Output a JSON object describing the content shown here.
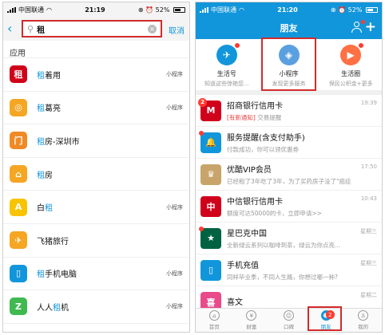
{
  "left": {
    "status": {
      "carrier": "中国联通",
      "time": "21:19",
      "battery": "52%"
    },
    "search": {
      "back_icon": "chevron-left-icon",
      "query": "租",
      "cancel_label": "取消"
    },
    "section_title": "应用",
    "apps": [
      {
        "prefix": "",
        "highlight": "租",
        "suffix": "着用",
        "tag": "小程序",
        "color": "#d0021b",
        "icon_glyph": "租"
      },
      {
        "prefix": "",
        "highlight": "租",
        "suffix": "葛亮",
        "tag": "小程序",
        "color": "#f5a623",
        "icon_glyph": "◎"
      },
      {
        "prefix": "",
        "highlight": "租",
        "suffix": "房-深圳市",
        "tag": "",
        "color": "#f08a24",
        "icon_glyph": "门"
      },
      {
        "prefix": "",
        "highlight": "租",
        "suffix": "房",
        "tag": "",
        "color": "#f5a623",
        "icon_glyph": "⌂"
      },
      {
        "prefix": "白",
        "highlight": "租",
        "suffix": "",
        "tag": "小程序",
        "color": "#f8c400",
        "icon_glyph": "A"
      },
      {
        "prefix": "飞猪旅行",
        "highlight": "",
        "suffix": "",
        "tag": "",
        "color": "#f5a623",
        "icon_glyph": "✈"
      },
      {
        "prefix": "",
        "highlight": "租",
        "suffix": "手机电脑",
        "tag": "小程序",
        "color": "#1296db",
        "icon_glyph": "▯"
      },
      {
        "prefix": "人人",
        "highlight": "租",
        "suffix": "机",
        "tag": "小程序",
        "color": "#3fb950",
        "icon_glyph": "Z"
      }
    ]
  },
  "right": {
    "status": {
      "carrier": "中国联通",
      "time": "21:20",
      "battery": "52%"
    },
    "nav": {
      "title": "朋友",
      "contacts_icon": "contacts-icon",
      "plus_icon": "plus-icon"
    },
    "grid": [
      {
        "label": "生活号",
        "sub": "知道这些惊艳您...",
        "color": "#1296db",
        "glyph": "✈",
        "dot": true
      },
      {
        "label": "小程序",
        "sub": "发现更多服务",
        "color": "#5aa0e0",
        "glyph": "◈",
        "dot": false
      },
      {
        "label": "生活圈",
        "sub": "保民公积金+更多",
        "color": "#ff7043",
        "glyph": "▶",
        "dot": true
      }
    ],
    "messages": [
      {
        "title": "招商银行信用卡",
        "sub_new": "[有新通知]",
        "sub": " 交易提醒",
        "time": "19:39",
        "color": "#d0021b",
        "glyph": "M",
        "badge": "2",
        "dot": false
      },
      {
        "title": "服务提醒(含支付助手)",
        "sub_new": "",
        "sub": "付款成功，你可以领优惠券",
        "time": "",
        "color": "#1296db",
        "glyph": "🔔",
        "badge": "",
        "dot": true
      },
      {
        "title": "优酷VIP会员",
        "sub_new": "",
        "sub": "已经租了3年吃了3年，为了买药房子没了\"癌症",
        "time": "17:50",
        "color": "#c8a46a",
        "glyph": "♛",
        "badge": "",
        "dot": false
      },
      {
        "title": "中信银行信用卡",
        "sub_new": "",
        "sub": "额度可达50000的卡，立即申请>>",
        "time": "10:43",
        "color": "#d0021b",
        "glyph": "中",
        "badge": "",
        "dot": false
      },
      {
        "title": "星巴克中国",
        "sub_new": "",
        "sub": "全新绿云系列以咖啡到茶，绿云为你点亮...",
        "time": "星期三",
        "color": "#006241",
        "glyph": "★",
        "badge": "",
        "dot": true
      },
      {
        "title": "手机充值",
        "sub_new": "",
        "sub": "同样毕业季，不同人生路，你想过哪一种?",
        "time": "星期三",
        "color": "#1296db",
        "glyph": "▯",
        "badge": "",
        "dot": false
      },
      {
        "title": "喜文",
        "sub_new": "",
        "sub": "",
        "time": "星期二",
        "color": "#e84a8a",
        "glyph": "喜",
        "badge": "",
        "dot": false
      }
    ],
    "tabs": [
      {
        "label": "首页",
        "icon": "home-icon",
        "glyph": "⌂",
        "active": false,
        "badge": ""
      },
      {
        "label": "财富",
        "icon": "wealth-icon",
        "glyph": "¥",
        "active": false,
        "badge": ""
      },
      {
        "label": "口碑",
        "icon": "koubei-icon",
        "glyph": "☺",
        "active": false,
        "badge": ""
      },
      {
        "label": "朋友",
        "icon": "friends-icon",
        "glyph": "☻",
        "active": true,
        "badge": "2"
      },
      {
        "label": "我的",
        "icon": "profile-icon",
        "glyph": "♙",
        "active": false,
        "badge": ""
      }
    ]
  }
}
